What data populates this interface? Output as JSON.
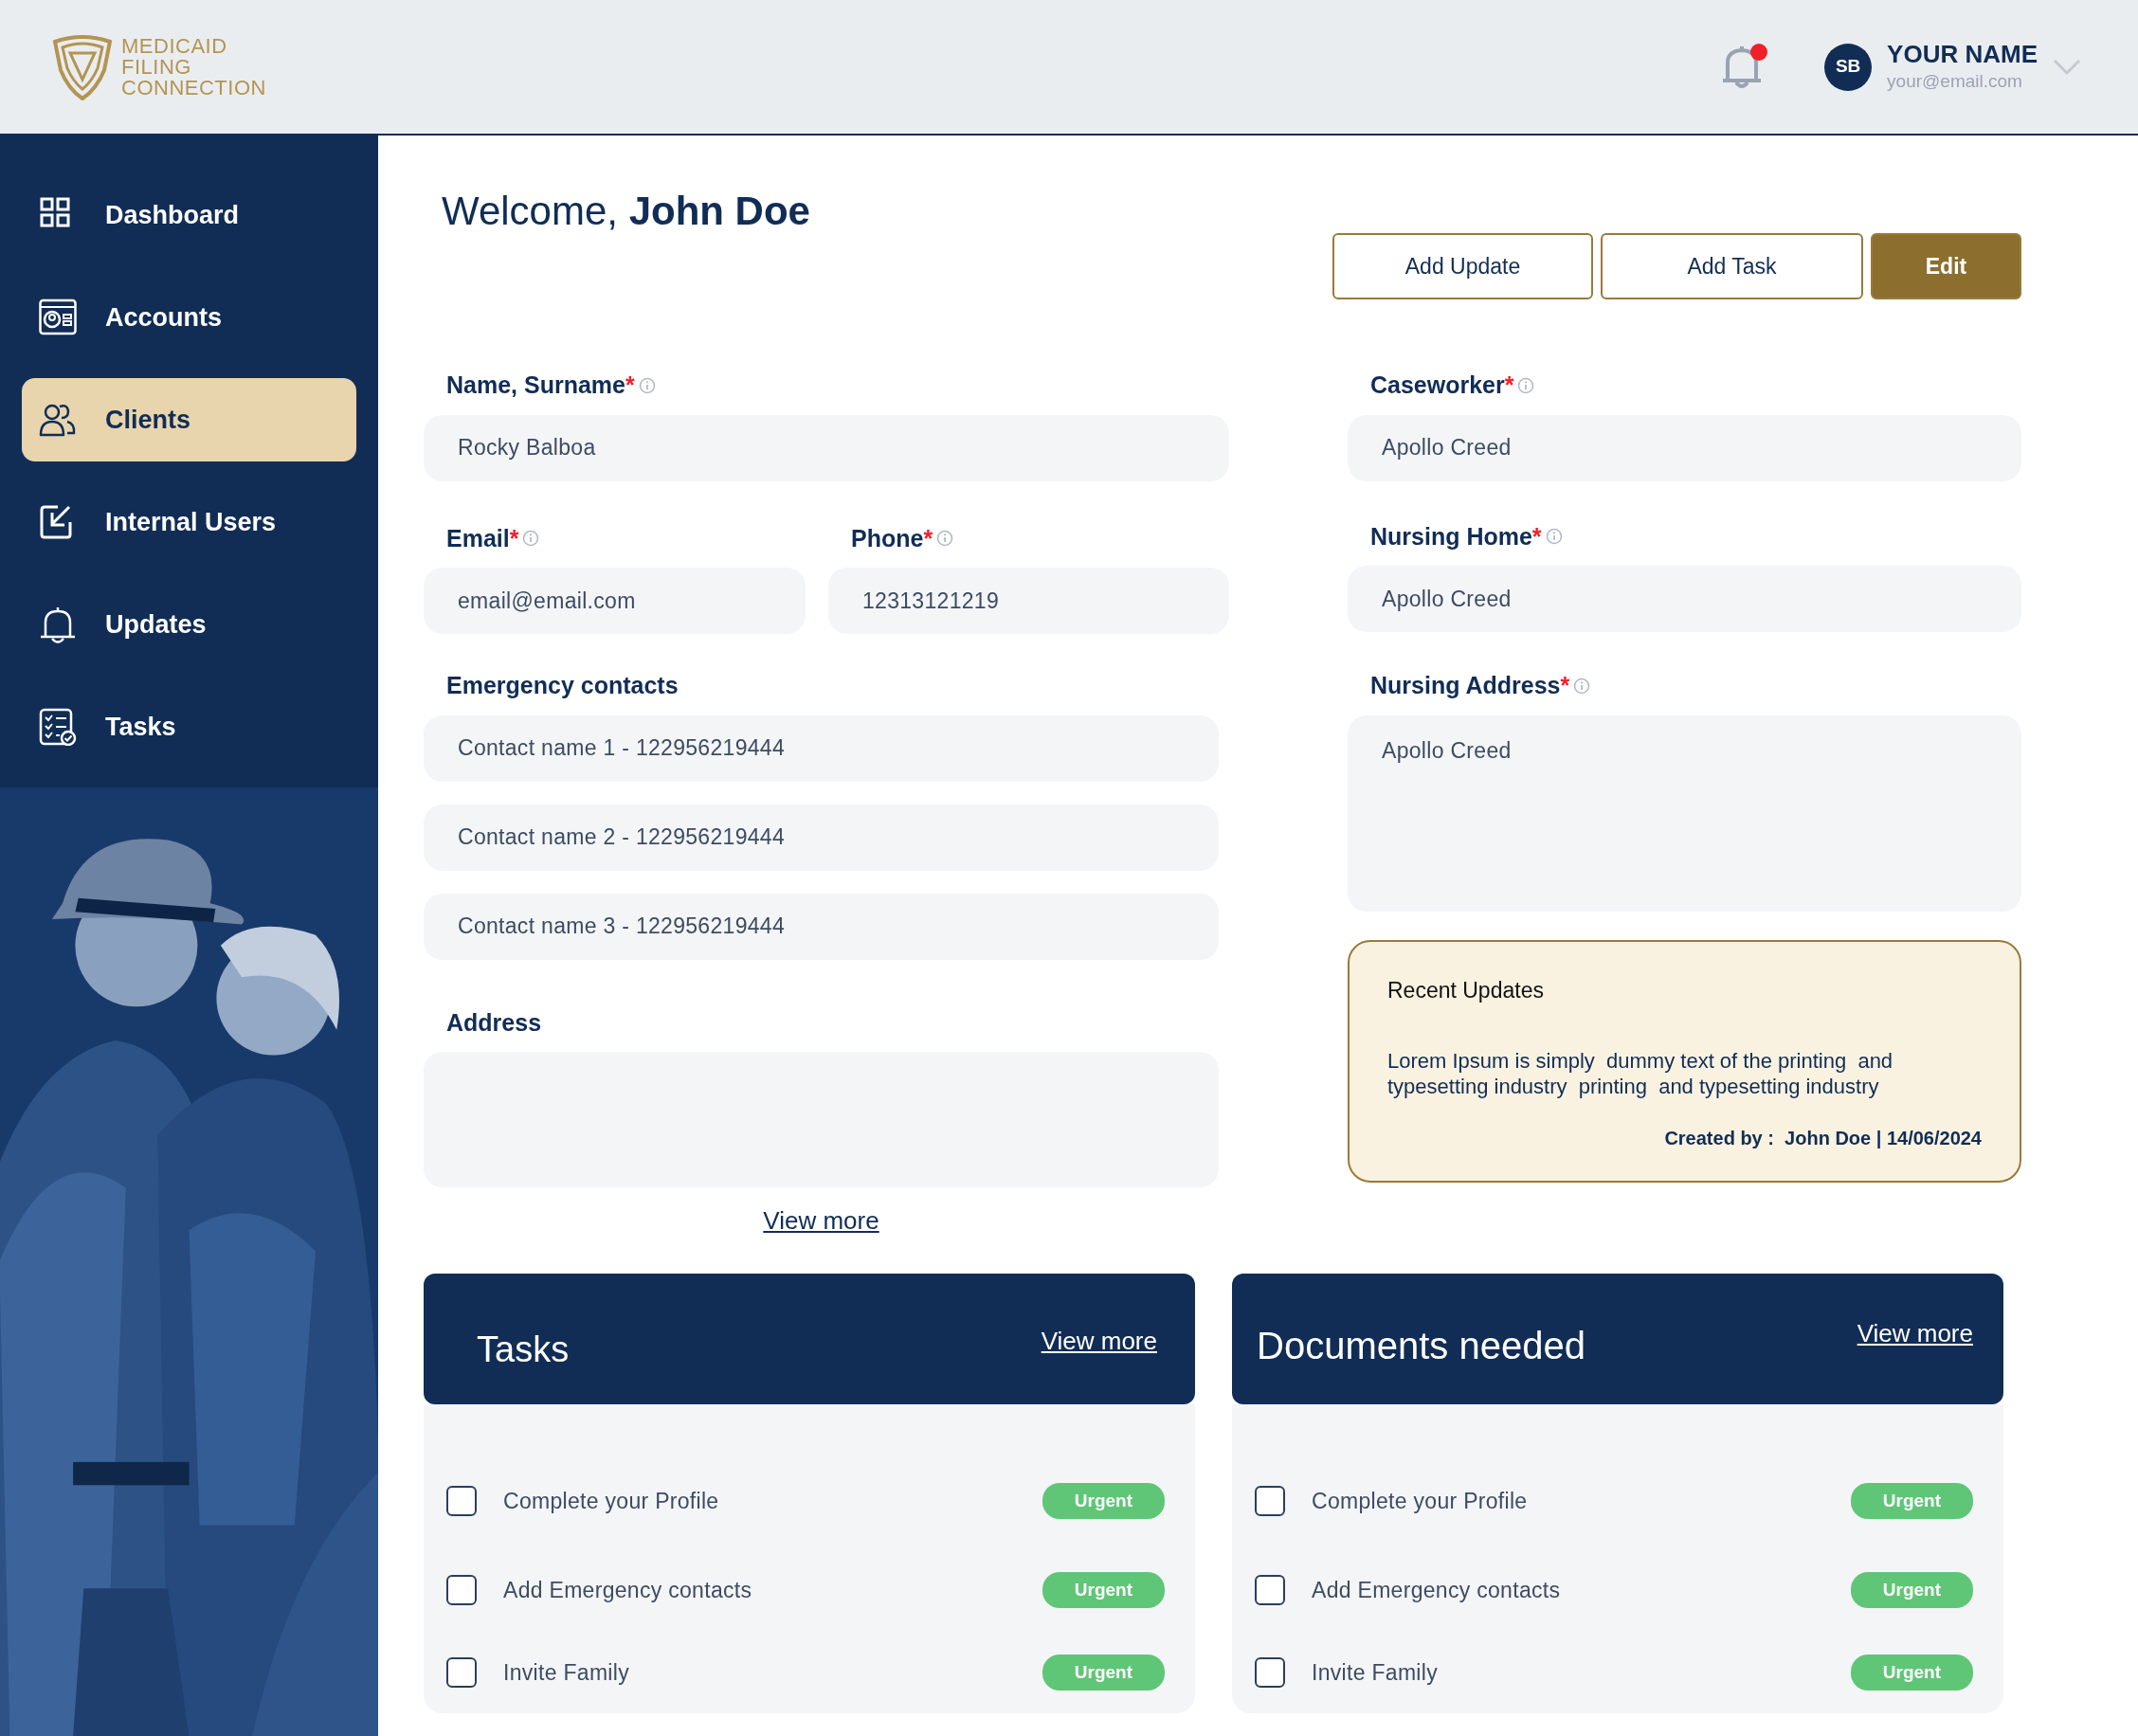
{
  "header": {
    "logo_lines": [
      "MEDICAID",
      "FILING",
      "CONNECTION"
    ],
    "notification": {
      "unread": true
    },
    "user": {
      "initials": "SB",
      "name": "YOUR NAME",
      "email": "your@email.com"
    }
  },
  "sidebar": {
    "items": [
      {
        "label": "Dashboard",
        "selected": false
      },
      {
        "label": "Accounts",
        "selected": false
      },
      {
        "label": "Clients",
        "selected": true
      },
      {
        "label": "Internal Users",
        "selected": false
      },
      {
        "label": "Updates",
        "selected": false
      },
      {
        "label": "Tasks",
        "selected": false
      }
    ]
  },
  "welcome": {
    "greeting": "Welcome,",
    "name": "John Doe"
  },
  "actions": [
    {
      "label": "Add Update",
      "primary": false
    },
    {
      "label": "Add Task",
      "primary": false
    },
    {
      "label": "Edit",
      "primary": true
    }
  ],
  "name_field": {
    "label": "Name, Surname",
    "required_mark": "*",
    "value": "Rocky Balboa"
  },
  "email_field": {
    "label": "Email",
    "required_mark": "*",
    "value": "email@email.com"
  },
  "phone_field": {
    "label": "Phone",
    "required_mark": "*",
    "value": "12313121219"
  },
  "emergency_contacts": {
    "label": "Emergency contacts",
    "entries": [
      "Contact name 1 - 122956219444",
      "Contact name 2 - 122956219444",
      "Contact name 3 - 122956219444"
    ]
  },
  "address": {
    "label": "Address"
  },
  "view_more": "View more",
  "caseworker": {
    "label": "Caseworker",
    "required_mark": "*",
    "value": "Apollo Creed"
  },
  "nursing_home": {
    "label": "Nursing Home",
    "required_mark": "*",
    "value": "Apollo Creed"
  },
  "nursing_address": {
    "label": "Nursing Address",
    "required_mark": "*",
    "value": "Apollo Creed"
  },
  "recent_updates": {
    "title": "Recent Updates",
    "text": "Lorem Ipsum is simply  dummy text of the printing  and typesetting industry  printing  and typesetting industry",
    "created_by": "Created by :  John Doe | 14/06/2024"
  },
  "panels": [
    {
      "title": "Tasks",
      "link": "View more",
      "items": [
        {
          "label": "Complete your Profile",
          "checked": false,
          "tag": "Urgent"
        },
        {
          "label": "Add Emergency contacts",
          "checked": false,
          "tag": "Urgent"
        },
        {
          "label": "Invite Family",
          "checked": false,
          "tag": "Urgent"
        }
      ]
    },
    {
      "title": "Documents needed",
      "link": "View more",
      "items": [
        {
          "label": "Complete your Profile",
          "checked": false,
          "tag": "Urgent"
        },
        {
          "label": "Add Emergency contacts",
          "checked": false,
          "tag": "Urgent"
        },
        {
          "label": "Invite Family",
          "checked": false,
          "tag": "Urgent"
        }
      ]
    }
  ]
}
